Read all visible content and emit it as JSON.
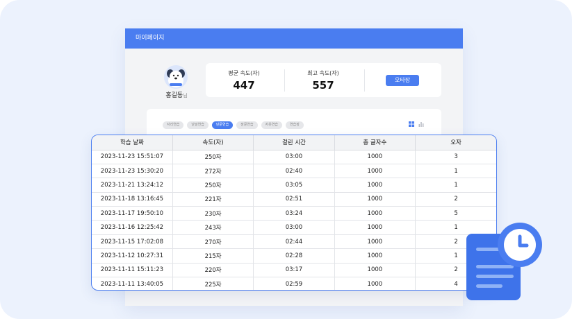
{
  "header": {
    "title": "마이페이지"
  },
  "profile": {
    "name": "홍길동",
    "suffix": "님"
  },
  "stats": {
    "avg_label": "평균 속도(자)",
    "avg_value": "447",
    "max_label": "최고 속도(자)",
    "max_value": "557",
    "typo_button": "오타장"
  },
  "filters": {
    "chips": [
      "자리연습",
      "낱말연습",
      "단문연습",
      "장문연습",
      "자유연습",
      "연습장"
    ],
    "active_index": 2
  },
  "table": {
    "headers": [
      "학습 날짜",
      "속도(자)",
      "걸린 시간",
      "총 글자수",
      "오자"
    ],
    "rows": [
      [
        "2023-11-23 15:51:07",
        "250자",
        "03:00",
        "1000",
        "3"
      ],
      [
        "2023-11-23 15:30:20",
        "272자",
        "02:40",
        "1000",
        "1"
      ],
      [
        "2023-11-21 13:24:12",
        "250자",
        "03:05",
        "1000",
        "1"
      ],
      [
        "2023-11-18 13:16:45",
        "221자",
        "02:51",
        "1000",
        "2"
      ],
      [
        "2023-11-17 19:50:10",
        "230자",
        "03:24",
        "1000",
        "5"
      ],
      [
        "2023-11-16 12:25:42",
        "243자",
        "03:00",
        "1000",
        "1"
      ],
      [
        "2023-11-15 17:02:08",
        "270자",
        "02:44",
        "1000",
        "2"
      ],
      [
        "2023-11-12 10:27:31",
        "215자",
        "02:28",
        "1000",
        "1"
      ],
      [
        "2023-11-11 15:11:23",
        "220자",
        "03:17",
        "1000",
        "2"
      ],
      [
        "2023-11-11 13:40:05",
        "225자",
        "02:59",
        "1000",
        "4"
      ]
    ]
  },
  "colors": {
    "primary": "#4a7df0",
    "background": "#ecf2fd"
  },
  "icons": [
    "avatar-dog-icon",
    "grid-view-icon",
    "chart-view-icon",
    "document-icon",
    "clock-icon"
  ]
}
